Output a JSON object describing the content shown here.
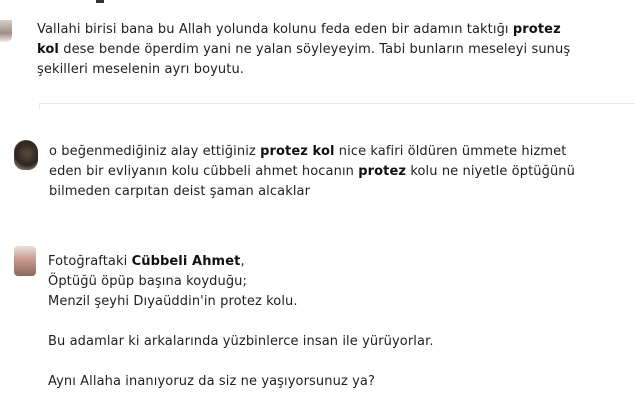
{
  "posts": [
    {
      "lines": [
        [
          {
            "t": "Vallahi birisi bana bu Allah yolunda kolunu feda eden bir adamın taktığı ",
            "b": false
          },
          {
            "t": "protez",
            "b": true
          }
        ],
        [
          {
            "t": "kol",
            "b": true
          },
          {
            "t": " dese bende öperdim yani ne yalan söyleyeyim. Tabi bunların meseleyi sunuş",
            "b": false
          }
        ],
        [
          {
            "t": "şekilleri meselenin ayrı boyutu.",
            "b": false
          }
        ]
      ]
    },
    {
      "lines": [
        [
          {
            "t": "o beğenmediğiniz alay ettiğiniz ",
            "b": false
          },
          {
            "t": "protez kol",
            "b": true
          },
          {
            "t": " nice kafiri  öldüren ümmete hizmet",
            "b": false
          }
        ],
        [
          {
            "t": "eden bir evliyanın kolu cübbeli ahmet hocanın ",
            "b": false
          },
          {
            "t": "protez",
            "b": true
          },
          {
            "t": " kolu ne niyetle öptüğünü",
            "b": false
          }
        ],
        [
          {
            "t": "bilmeden carpıtan deist şaman  alcaklar",
            "b": false
          }
        ]
      ]
    },
    {
      "lines": [
        [
          {
            "t": "Fotoğraftaki ",
            "b": false
          },
          {
            "t": "Cübbeli Ahmet",
            "b": true
          },
          {
            "t": ",",
            "b": false
          }
        ],
        [
          {
            "t": "Öptüğü öpüp başına koyduğu;",
            "b": false
          }
        ],
        [
          {
            "t": "Menzil şeyhi Dıyaüddin'in protez kolu.",
            "b": false
          }
        ],
        [],
        [
          {
            "t": "Bu adamlar ki arkalarında yüzbinlerce insan ile yürüyorlar.",
            "b": false
          }
        ],
        [],
        [
          {
            "t": "Aynı Allaha inanıyoruz da siz ne yaşıyorsunuz ya?",
            "b": false
          }
        ]
      ]
    }
  ]
}
